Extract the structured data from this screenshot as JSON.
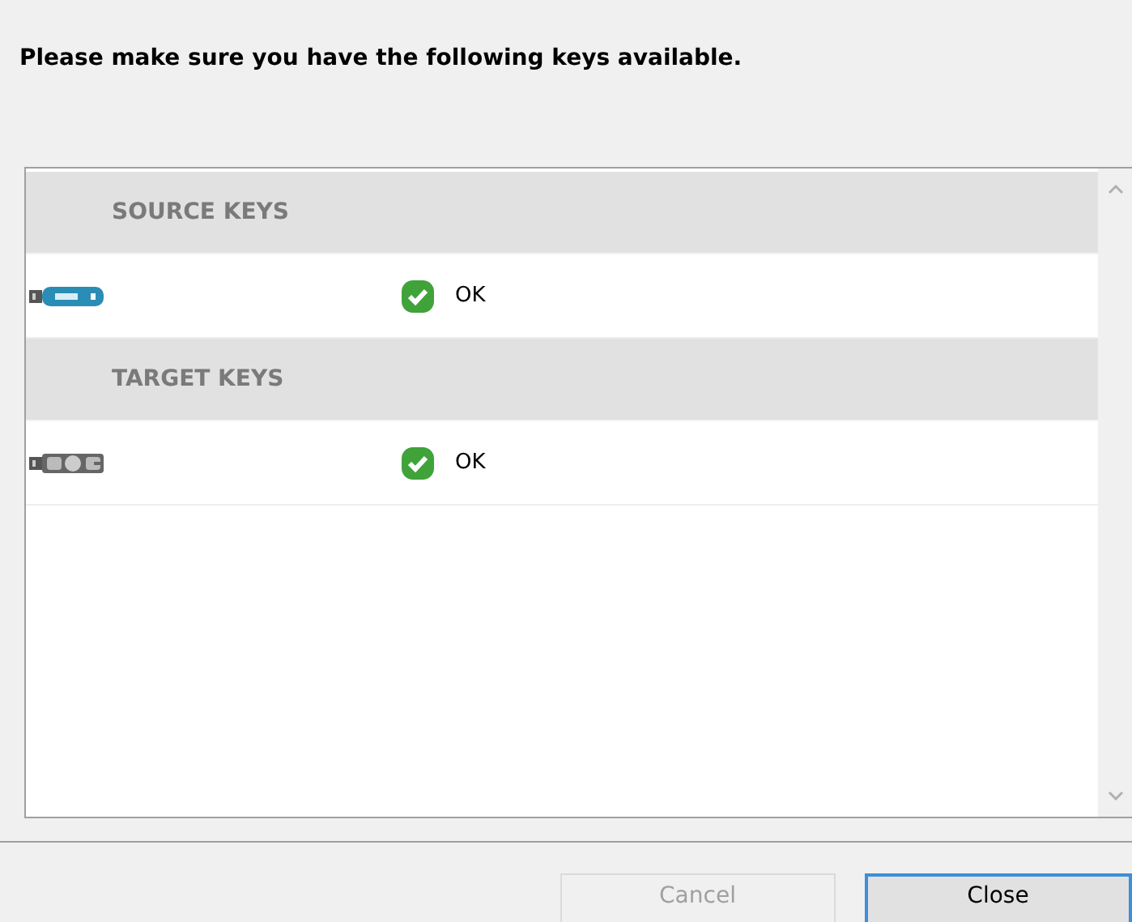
{
  "instruction": "Please make sure you have the following keys available.",
  "sections": [
    {
      "title": "SOURCE KEYS",
      "keys": [
        {
          "kind": "usb-stick",
          "status": "OK"
        }
      ]
    },
    {
      "title": "TARGET KEYS",
      "keys": [
        {
          "kind": "dongle",
          "status": "OK"
        }
      ]
    }
  ],
  "buttons": [
    {
      "label": "Cancel",
      "disabled": true,
      "default": false
    },
    {
      "label": "Close",
      "disabled": false,
      "default": true
    }
  ]
}
